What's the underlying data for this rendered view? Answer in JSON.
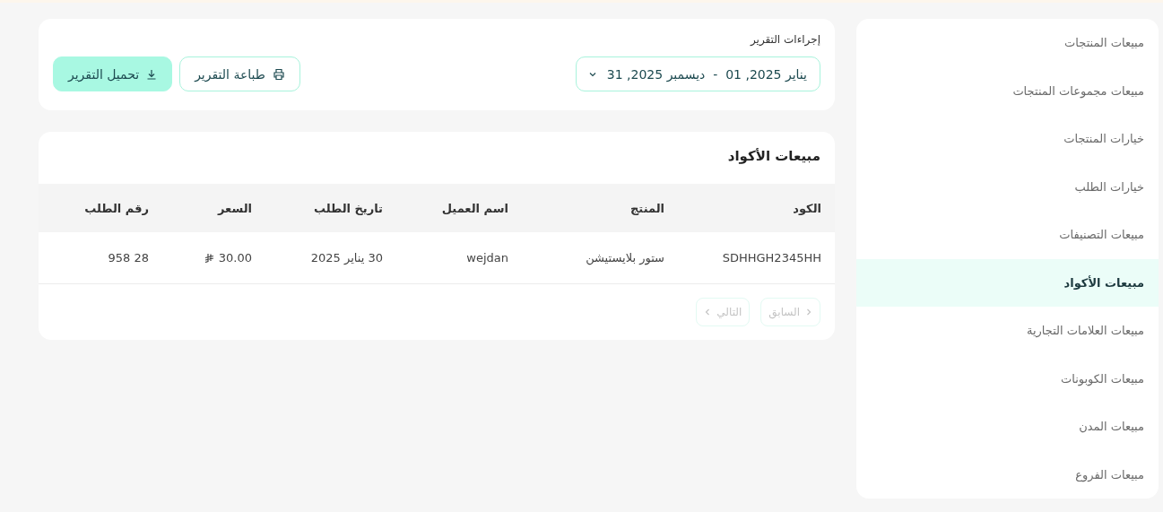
{
  "sidebar": {
    "items": [
      {
        "label": "مبيعات المنتجات",
        "selected": false
      },
      {
        "label": "مبيعات مجموعات المنتجات",
        "selected": false
      },
      {
        "label": "خيارات المنتجات",
        "selected": false
      },
      {
        "label": "خيارات الطلب",
        "selected": false
      },
      {
        "label": "مبيعات التصنيفات",
        "selected": false
      },
      {
        "label": "مبيعات الأكواد",
        "selected": true
      },
      {
        "label": "مبيعات العلامات التجارية",
        "selected": false
      },
      {
        "label": "مبيعات الكوبونات",
        "selected": false
      },
      {
        "label": "مبيعات المدن",
        "selected": false
      },
      {
        "label": "مبيعات الفروع",
        "selected": false
      }
    ]
  },
  "report_actions": {
    "title": "إجراءات التقرير",
    "date_range": "يناير 2025, 01  -  ديسمبر 2025, 31",
    "buttons": [
      {
        "label": "طباعة التقرير",
        "kind": "print"
      },
      {
        "label": "تحميل التقرير",
        "kind": "download"
      }
    ]
  },
  "table": {
    "title": "مبيعات الأكواد",
    "columns": [
      "الكود",
      "المنتج",
      "اسم العميل",
      "تاريخ الطلب",
      "السعر",
      "رقم الطلب"
    ],
    "rows": [
      [
        "SDHHGH2345HH",
        "ستور بلايستيشن",
        "wejdan",
        "30 يناير 2025",
        "30.00",
        "28 958"
      ]
    ]
  },
  "pagination": [
    {
      "label": "السابق",
      "kind": "prev",
      "disabled": true
    },
    {
      "label": "التالي",
      "kind": "next",
      "disabled": true
    }
  ]
}
